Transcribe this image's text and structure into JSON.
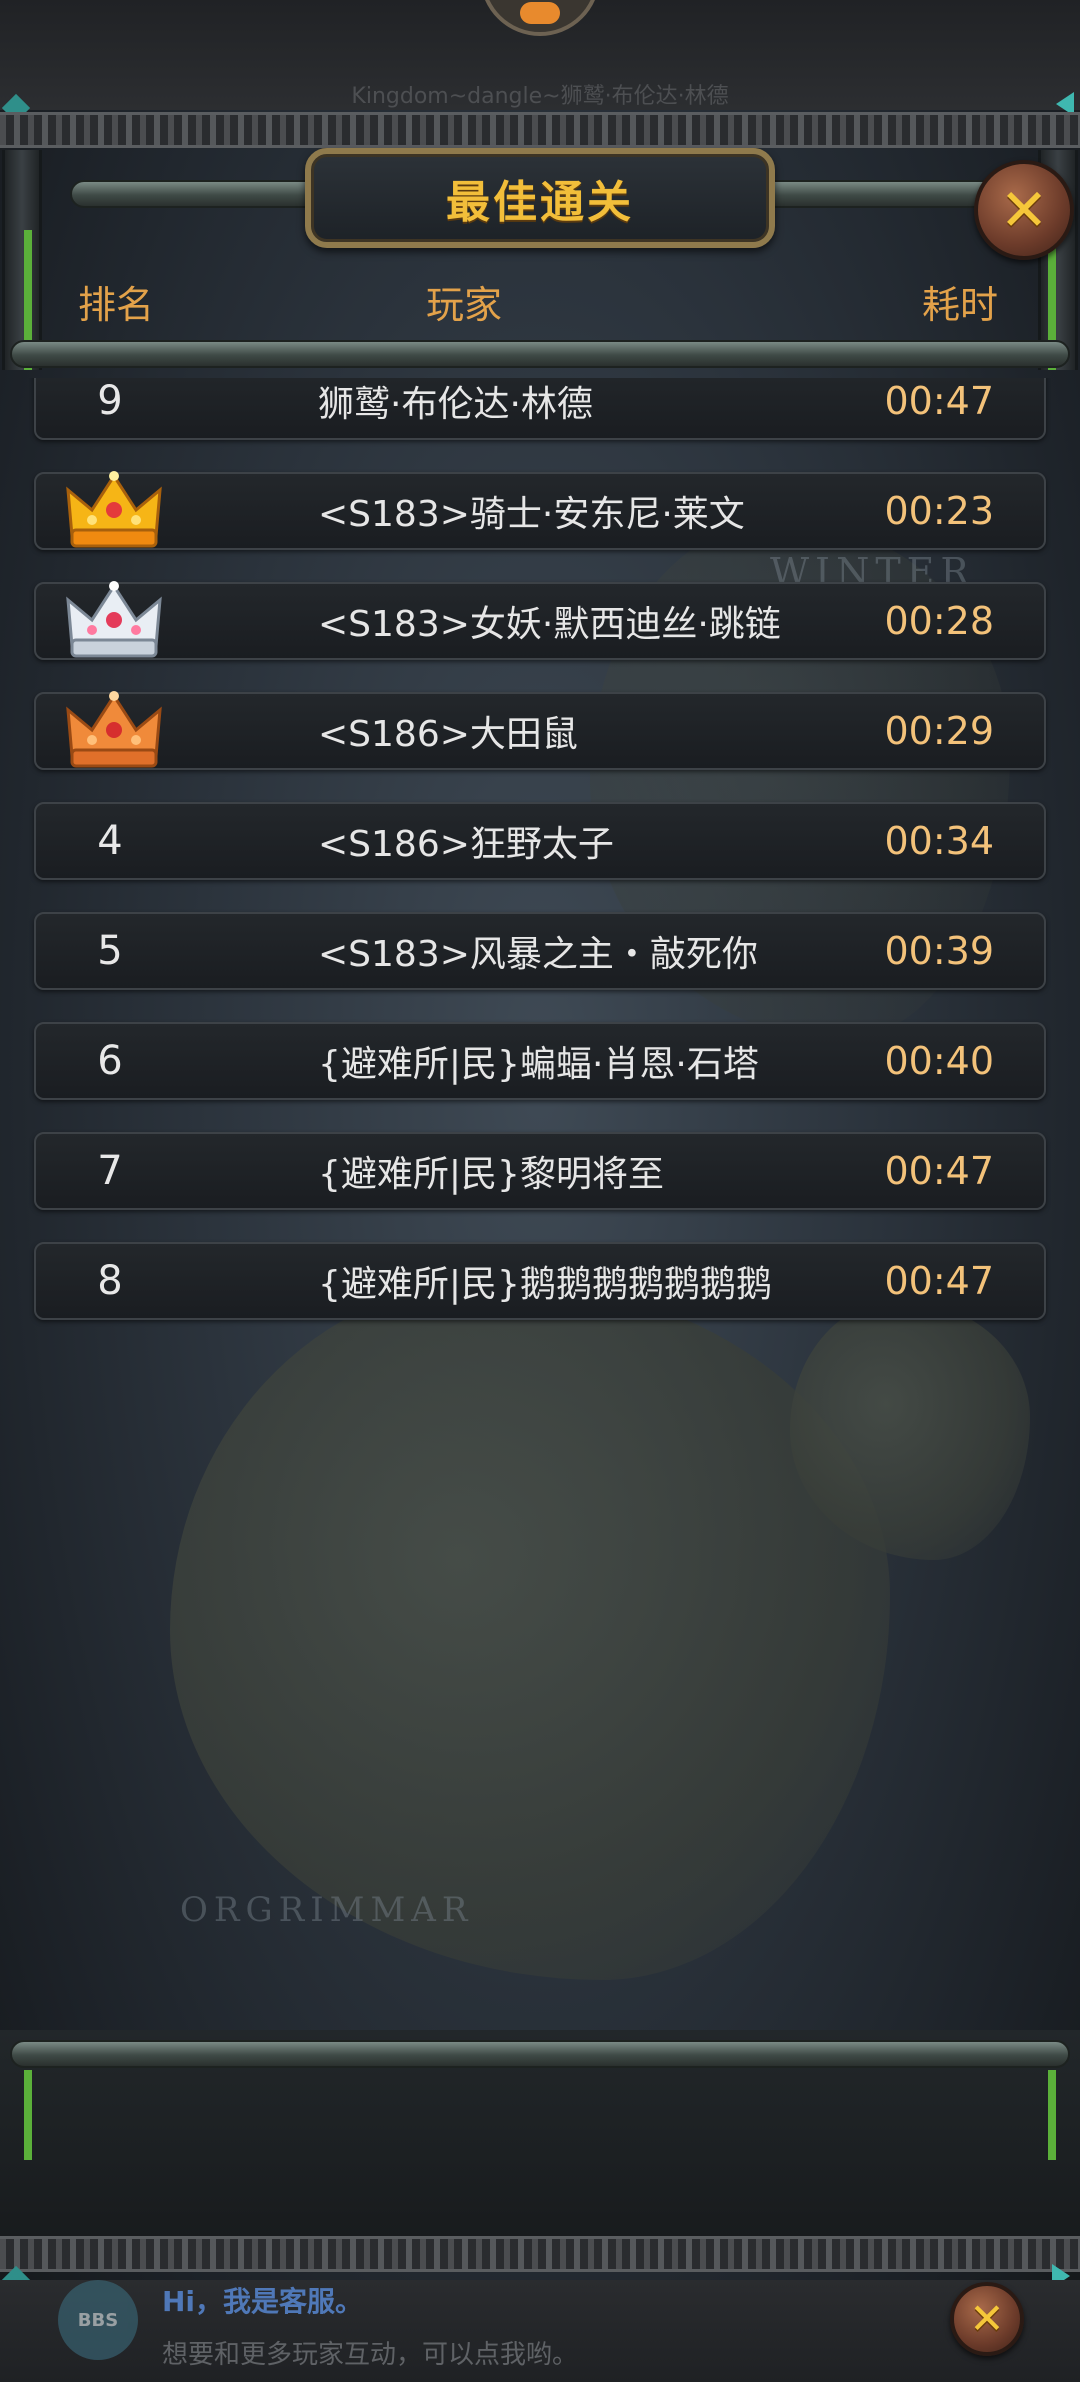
{
  "header": {
    "top_caption": "Kingdom~dangle~狮鹫·布伦达·林德",
    "title": "最佳通关",
    "close_icon": "close-x-icon"
  },
  "columns": {
    "rank": "排名",
    "player": "玩家",
    "time": "耗时"
  },
  "rows": [
    {
      "rank": "9",
      "name": "狮鹫·布伦达·林德",
      "time": "00:47",
      "badge": null
    },
    {
      "rank": "1",
      "name": "<S183>骑士·安东尼·莱文",
      "time": "00:23",
      "badge": "gold-crown-icon"
    },
    {
      "rank": "2",
      "name": "<S183>女妖·默西迪丝·跳链",
      "time": "00:28",
      "badge": "silver-crown-icon"
    },
    {
      "rank": "3",
      "name": "<S186>大田鼠",
      "time": "00:29",
      "badge": "bronze-crown-icon"
    },
    {
      "rank": "4",
      "name": "<S186>狂野太子",
      "time": "00:34",
      "badge": null
    },
    {
      "rank": "5",
      "name": "<S183>风暴之主・敲死你",
      "time": "00:39",
      "badge": null
    },
    {
      "rank": "6",
      "name": "{避难所|民}蝙蝠·肖恩·石塔",
      "time": "00:40",
      "badge": null
    },
    {
      "rank": "7",
      "name": "{避难所|民}黎明将至",
      "time": "00:47",
      "badge": null
    },
    {
      "rank": "8",
      "name": "{避难所|民}鹅鹅鹅鹅鹅鹅鹅",
      "time": "00:47",
      "badge": null
    }
  ],
  "map_labels": {
    "orgrimmar": "ORGRIMMAR",
    "winter": "WINTER"
  },
  "bbs": {
    "logo": "BBS",
    "greeting": "Hi，我是客服。",
    "prompt": "想要和更多玩家互动，可以点我哟。",
    "close_icon": "close-x-icon"
  },
  "colors": {
    "title_gold": "#f2be3a",
    "header_orange": "#e3a24a",
    "time_orange": "#f3c27a",
    "accent_green": "#5bb03a"
  }
}
